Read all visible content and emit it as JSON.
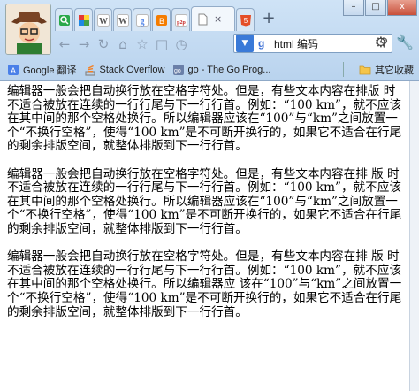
{
  "tabs": [
    {
      "name": "tab-1",
      "icon": "green-search-icon",
      "color": "#2aa84a"
    },
    {
      "name": "tab-2",
      "icon": "colorful-grid-icon",
      "color": "#e64a19"
    },
    {
      "name": "tab-3",
      "icon": "w-icon",
      "letter": "W",
      "color": "#555555"
    },
    {
      "name": "tab-4",
      "icon": "w-icon",
      "letter": "W",
      "color": "#555555"
    },
    {
      "name": "tab-5",
      "icon": "google-icon",
      "letter": "g",
      "color": "#4a80e8"
    },
    {
      "name": "tab-6",
      "icon": "blogger-icon",
      "color": "#f57c00"
    },
    {
      "name": "tab-7",
      "icon": "p2p-icon",
      "letter": "p2p",
      "color": "#c62828"
    },
    {
      "name": "tab-8",
      "icon": "document-icon",
      "active": true
    },
    {
      "name": "tab-9",
      "icon": "html5-icon",
      "color": "#e44d26"
    }
  ],
  "window": {
    "minimize": "–",
    "maximize": "□",
    "close": "x"
  },
  "omnibox": {
    "text": "html 编码",
    "search_engine_letter": "g"
  },
  "bookmarks": [
    {
      "icon": "google-translate-icon",
      "label": "Google 翻译"
    },
    {
      "icon": "stack-overflow-icon",
      "label": "Stack Overflow"
    },
    {
      "icon": "go-icon",
      "label": "go - The Go Prog..."
    }
  ],
  "bookmarks_folder": {
    "label": "其它收藏"
  },
  "paragraphs": [
    "编辑器一般会把自动换行放在空格字符处。但是，有些文本内容在排版 时不适合被放在连续的一行行尾与下一行行首。例如：“100 km”，就不应该在其中间的那个空格处换行。所以编辑器应该在“100”与“km”之间放置一个“不换行空格”，使得“100 km”是不可断开换行的，如果它不适合在行尾的剩余排版空间，就整体排版到下一行行首。",
    "编辑器一般会把自动换行放在空格字符处。但是，有些文本内容在排 版 时不适合被放在连续的一行行尾与下一行行首。例如：“100 km”，就不应该在其中间的那个空格处换行。所以编辑器应该在“100”与“km”之间放置一个“不换行空格”，使得“100 km”是不可断开换行的，如果它不适合在行尾的剩余排版空间，就整体排版到下一行行首。",
    "编辑器一般会把自动换行放在空格字符处。但是，有些文本内容在排 版 时不适合被放在连续的一行行尾与下一行行首。例如：“100 km”，就不应该在其中间的那个空格处换行。所以编辑器应 该在“100”与“km”之间放置一个“不换行空格”，使得“100 km”是不可断开换行的，如果它不适合在行尾的剩余排版空间，就整体排版到下一行行首。"
  ]
}
